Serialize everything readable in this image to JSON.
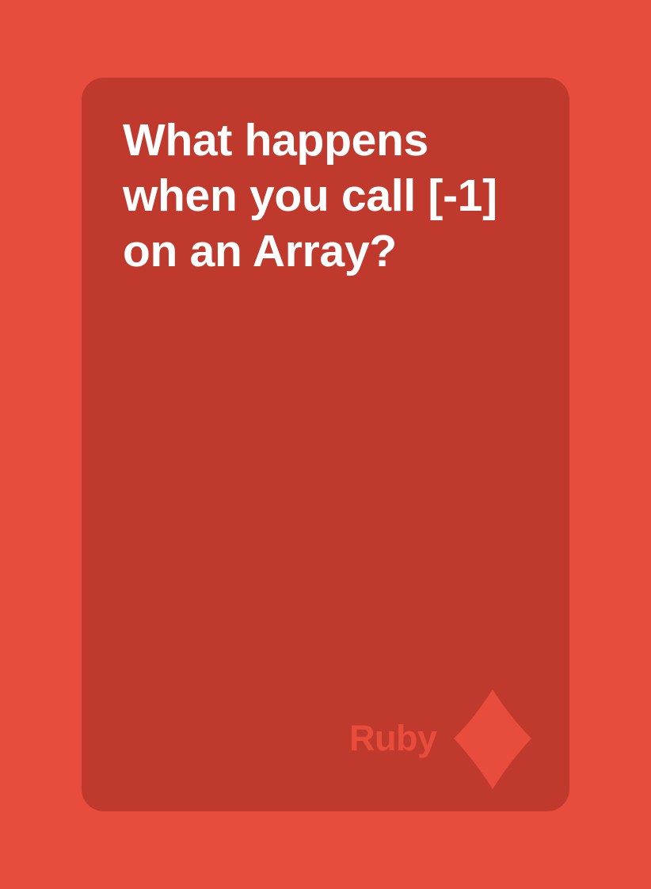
{
  "card": {
    "question_lines": [
      "What happens",
      "when you call [-1]",
      "on an Array?"
    ],
    "category": "Ruby",
    "suit_icon": "diamond-icon"
  },
  "colors": {
    "background": "#e84c3d",
    "card": "#c0392d",
    "question_text": "#ffffff",
    "accent": "#e84c3d"
  }
}
